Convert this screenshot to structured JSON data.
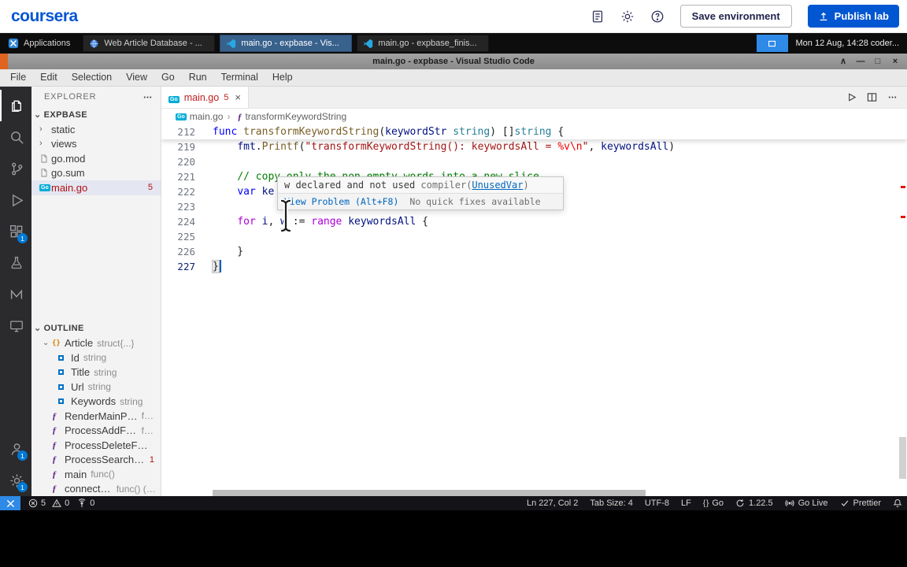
{
  "coursera": {
    "logo": "coursera",
    "save_environment_label": "Save environment",
    "publish_lab_label": "Publish lab",
    "brand_color": "#0056d2"
  },
  "taskbar": {
    "applications_label": "Applications",
    "windows": [
      {
        "name": "window-web-article-database",
        "icon": "globe",
        "label": "Web Article Database - ...",
        "cls": ""
      },
      {
        "name": "window-main-go-expbase",
        "icon": "vscode",
        "label": "main.go - expbase - Vis...",
        "cls": "active"
      },
      {
        "name": "window-main-go-expbase-finis",
        "icon": "vscode",
        "label": "main.go - expbase_finis...",
        "cls": ""
      }
    ],
    "clock": "Mon 12 Aug, 14:28 coder..."
  },
  "window": {
    "title": "main.go - expbase - Visual Studio Code",
    "controls": [
      {
        "name": "window-shade-button",
        "glyph": "∧"
      },
      {
        "name": "window-minimize-button",
        "glyph": "—"
      },
      {
        "name": "window-maximize-button",
        "glyph": "□"
      },
      {
        "name": "window-close-button",
        "glyph": "×"
      }
    ]
  },
  "menubar": {
    "items": [
      {
        "label": "File"
      },
      {
        "label": "Edit"
      },
      {
        "label": "Selection"
      },
      {
        "label": "View"
      },
      {
        "label": "Go"
      },
      {
        "label": "Run"
      },
      {
        "label": "Terminal"
      },
      {
        "label": "Help"
      }
    ]
  },
  "activity": {
    "top": [
      {
        "name": "activity-explorer",
        "icon": "files",
        "cls": "active"
      },
      {
        "name": "activity-search",
        "icon": "search",
        "cls": ""
      },
      {
        "name": "activity-source-control",
        "icon": "scm",
        "cls": ""
      },
      {
        "name": "activity-run-debug",
        "icon": "debug",
        "cls": ""
      },
      {
        "name": "activity-extensions",
        "icon": "extensions",
        "badge": "1",
        "cls": ""
      },
      {
        "name": "activity-testing",
        "icon": "flask",
        "cls": ""
      },
      {
        "name": "activity-extension-m",
        "icon": "mlogo",
        "cls": ""
      },
      {
        "name": "activity-live-server",
        "icon": "monitor",
        "cls": ""
      }
    ],
    "bottom": [
      {
        "name": "activity-account",
        "icon": "account",
        "badge": "1",
        "cls": ""
      },
      {
        "name": "activity-settings",
        "icon": "gearlg",
        "badge": "1",
        "cls": ""
      }
    ]
  },
  "explorer": {
    "title": "EXPLORER",
    "root": "EXPBASE",
    "items": [
      {
        "name": "folder-static",
        "icon": "chevron",
        "label": "static",
        "cls": ""
      },
      {
        "name": "folder-views",
        "icon": "chevron",
        "label": "views",
        "cls": ""
      },
      {
        "name": "file-go-mod",
        "icon": "file",
        "label": "go.mod",
        "cls": ""
      },
      {
        "name": "file-go-sum",
        "icon": "file",
        "label": "go.sum",
        "cls": ""
      },
      {
        "name": "file-main-go",
        "icon": "gofile",
        "label": "main.go",
        "badge": "5",
        "cls": "selected error"
      }
    ]
  },
  "outline": {
    "title": "OUTLINE",
    "items": [
      {
        "name": "outline-article",
        "twisty": "⌄",
        "icon": "symstruct",
        "label": "Article",
        "detail": "struct{...}",
        "cls": ""
      },
      {
        "name": "outline-id",
        "twisty": "",
        "icon": "symfield",
        "label": "Id",
        "detail": "string",
        "cls": "lvl2"
      },
      {
        "name": "outline-title-field",
        "twisty": "",
        "icon": "symfield",
        "label": "Title",
        "detail": "string",
        "cls": "lvl2"
      },
      {
        "name": "outline-url",
        "twisty": "",
        "icon": "symfield",
        "label": "Url",
        "detail": "string",
        "cls": "lvl2"
      },
      {
        "name": "outline-keywords",
        "twisty": "",
        "icon": "symfield",
        "label": "Keywords",
        "detail": "string",
        "cls": "lvl2"
      },
      {
        "name": "outline-rendermainpage",
        "twisty": "",
        "icon": "symmethod",
        "label": "RenderMainPage",
        "detail": "fu...",
        "cls": ""
      },
      {
        "name": "outline-processaddform",
        "twisty": "",
        "icon": "symmethod",
        "label": "ProcessAddForm",
        "detail": "fu...",
        "cls": ""
      },
      {
        "name": "outline-processdeleteform",
        "twisty": "",
        "icon": "symmethod",
        "label": "ProcessDeleteForm...",
        "detail": "",
        "cls": ""
      },
      {
        "name": "outline-processsearchf",
        "twisty": "",
        "icon": "symmethod",
        "label": "ProcessSearchF...",
        "detail": "",
        "badge": "1",
        "cls": ""
      },
      {
        "name": "outline-main",
        "twisty": "",
        "icon": "symfunc",
        "label": "main",
        "detail": "func()",
        "cls": ""
      },
      {
        "name": "outline-connectdb",
        "twisty": "",
        "icon": "symfunc",
        "label": "connectDB",
        "detail": "func() (*...",
        "cls": ""
      }
    ]
  },
  "editor": {
    "tab": {
      "icon": "gofile",
      "label": "main.go",
      "badge": "5",
      "close": "×"
    },
    "actions": [
      {
        "name": "run-button",
        "icon": "run"
      },
      {
        "name": "split-editor-button",
        "icon": "split"
      },
      {
        "name": "more-actions-button",
        "icon": "more"
      }
    ],
    "breadcrumb": [
      {
        "name": "breadcrumb-file",
        "icon": "gofile",
        "label": "main.go"
      },
      {
        "name": "breadcrumb-symbol",
        "icon": "symmethod",
        "label": "transformKeywordString"
      }
    ],
    "code": {
      "sticky": {
        "num": "212",
        "tokens": [
          {
            "t": "func ",
            "c": "kw"
          },
          {
            "t": "transformKeywordString",
            "c": "fn"
          },
          {
            "t": "(",
            "c": "pt"
          },
          {
            "t": "keywordStr ",
            "c": "vr"
          },
          {
            "t": "string",
            "c": "ty"
          },
          {
            "t": ") []",
            "c": "pt"
          },
          {
            "t": "string",
            "c": "ty"
          },
          {
            "t": " {",
            "c": "pt"
          }
        ]
      },
      "lines": [
        {
          "num": "219",
          "cls": "",
          "tokens": [
            {
              "t": "    ",
              "c": "pt"
            },
            {
              "t": "fmt",
              "c": "vr"
            },
            {
              "t": ".",
              "c": "pt"
            },
            {
              "t": "Printf",
              "c": "fn"
            },
            {
              "t": "(",
              "c": "pt"
            },
            {
              "t": "\"transformKeywordString(): keywordsAll = ",
              "c": "st"
            },
            {
              "t": "%v",
              "c": "esc"
            },
            {
              "t": "\\n",
              "c": "esc"
            },
            {
              "t": "\"",
              "c": "st"
            },
            {
              "t": ", ",
              "c": "pt"
            },
            {
              "t": "keywordsAll",
              "c": "vr"
            },
            {
              "t": ")",
              "c": "pt"
            }
          ]
        },
        {
          "num": "220",
          "cls": "",
          "tokens": []
        },
        {
          "num": "221",
          "cls": "",
          "tokens": [
            {
              "t": "    ",
              "c": "pt"
            },
            {
              "t": "// copy only the non-empty words into a new slice",
              "c": "cm"
            }
          ]
        },
        {
          "num": "222",
          "cls": "",
          "tokens": [
            {
              "t": "    ",
              "c": "pt"
            },
            {
              "t": "var",
              "c": "kw"
            },
            {
              "t": " ",
              "c": "pt"
            },
            {
              "t": "ke",
              "c": "vr"
            }
          ]
        },
        {
          "num": "223",
          "cls": "",
          "tokens": []
        },
        {
          "num": "224",
          "cls": "",
          "tokens": [
            {
              "t": "    ",
              "c": "pt"
            },
            {
              "t": "for",
              "c": "ctl"
            },
            {
              "t": " ",
              "c": "pt"
            },
            {
              "t": "i",
              "c": "vr"
            },
            {
              "t": ", ",
              "c": "pt"
            },
            {
              "t": "w",
              "c": "vr sq"
            },
            {
              "t": " := ",
              "c": "pt"
            },
            {
              "t": "range",
              "c": "ctl"
            },
            {
              "t": " ",
              "c": "pt"
            },
            {
              "t": "keywordsAll",
              "c": "vr"
            },
            {
              "t": " {",
              "c": "pt"
            }
          ]
        },
        {
          "num": "225",
          "cls": "",
          "tokens": []
        },
        {
          "num": "226",
          "cls": "",
          "tokens": [
            {
              "t": "    }",
              "c": "pt"
            }
          ]
        },
        {
          "num": "227",
          "cls": "cur",
          "tokens": [
            {
              "t": "}",
              "c": "pt bm"
            }
          ]
        }
      ]
    },
    "hover": {
      "message": "w declared and not used ",
      "source_prefix": "compiler(",
      "source_link": "UnusedVar",
      "source_suffix": ")",
      "action": "View Problem (Alt+F8)",
      "note": "No quick fixes available"
    }
  },
  "status": {
    "errors": "5",
    "warnings": "0",
    "ports": "0",
    "right": [
      {
        "name": "status-cursor-position",
        "icon": "",
        "label": "Ln 227, Col 2"
      },
      {
        "name": "status-tab-size",
        "icon": "",
        "label": "Tab Size: 4"
      },
      {
        "name": "status-encoding",
        "icon": "",
        "label": "UTF-8"
      },
      {
        "name": "status-eol",
        "icon": "",
        "label": "LF"
      },
      {
        "name": "status-language",
        "icon": "braces",
        "label": "Go"
      },
      {
        "name": "status-go-version",
        "icon": "sync",
        "label": "1.22.5"
      },
      {
        "name": "status-go-live",
        "icon": "broadcast",
        "label": "Go Live"
      },
      {
        "name": "status-prettier",
        "icon": "check",
        "label": "Prettier"
      }
    ]
  }
}
